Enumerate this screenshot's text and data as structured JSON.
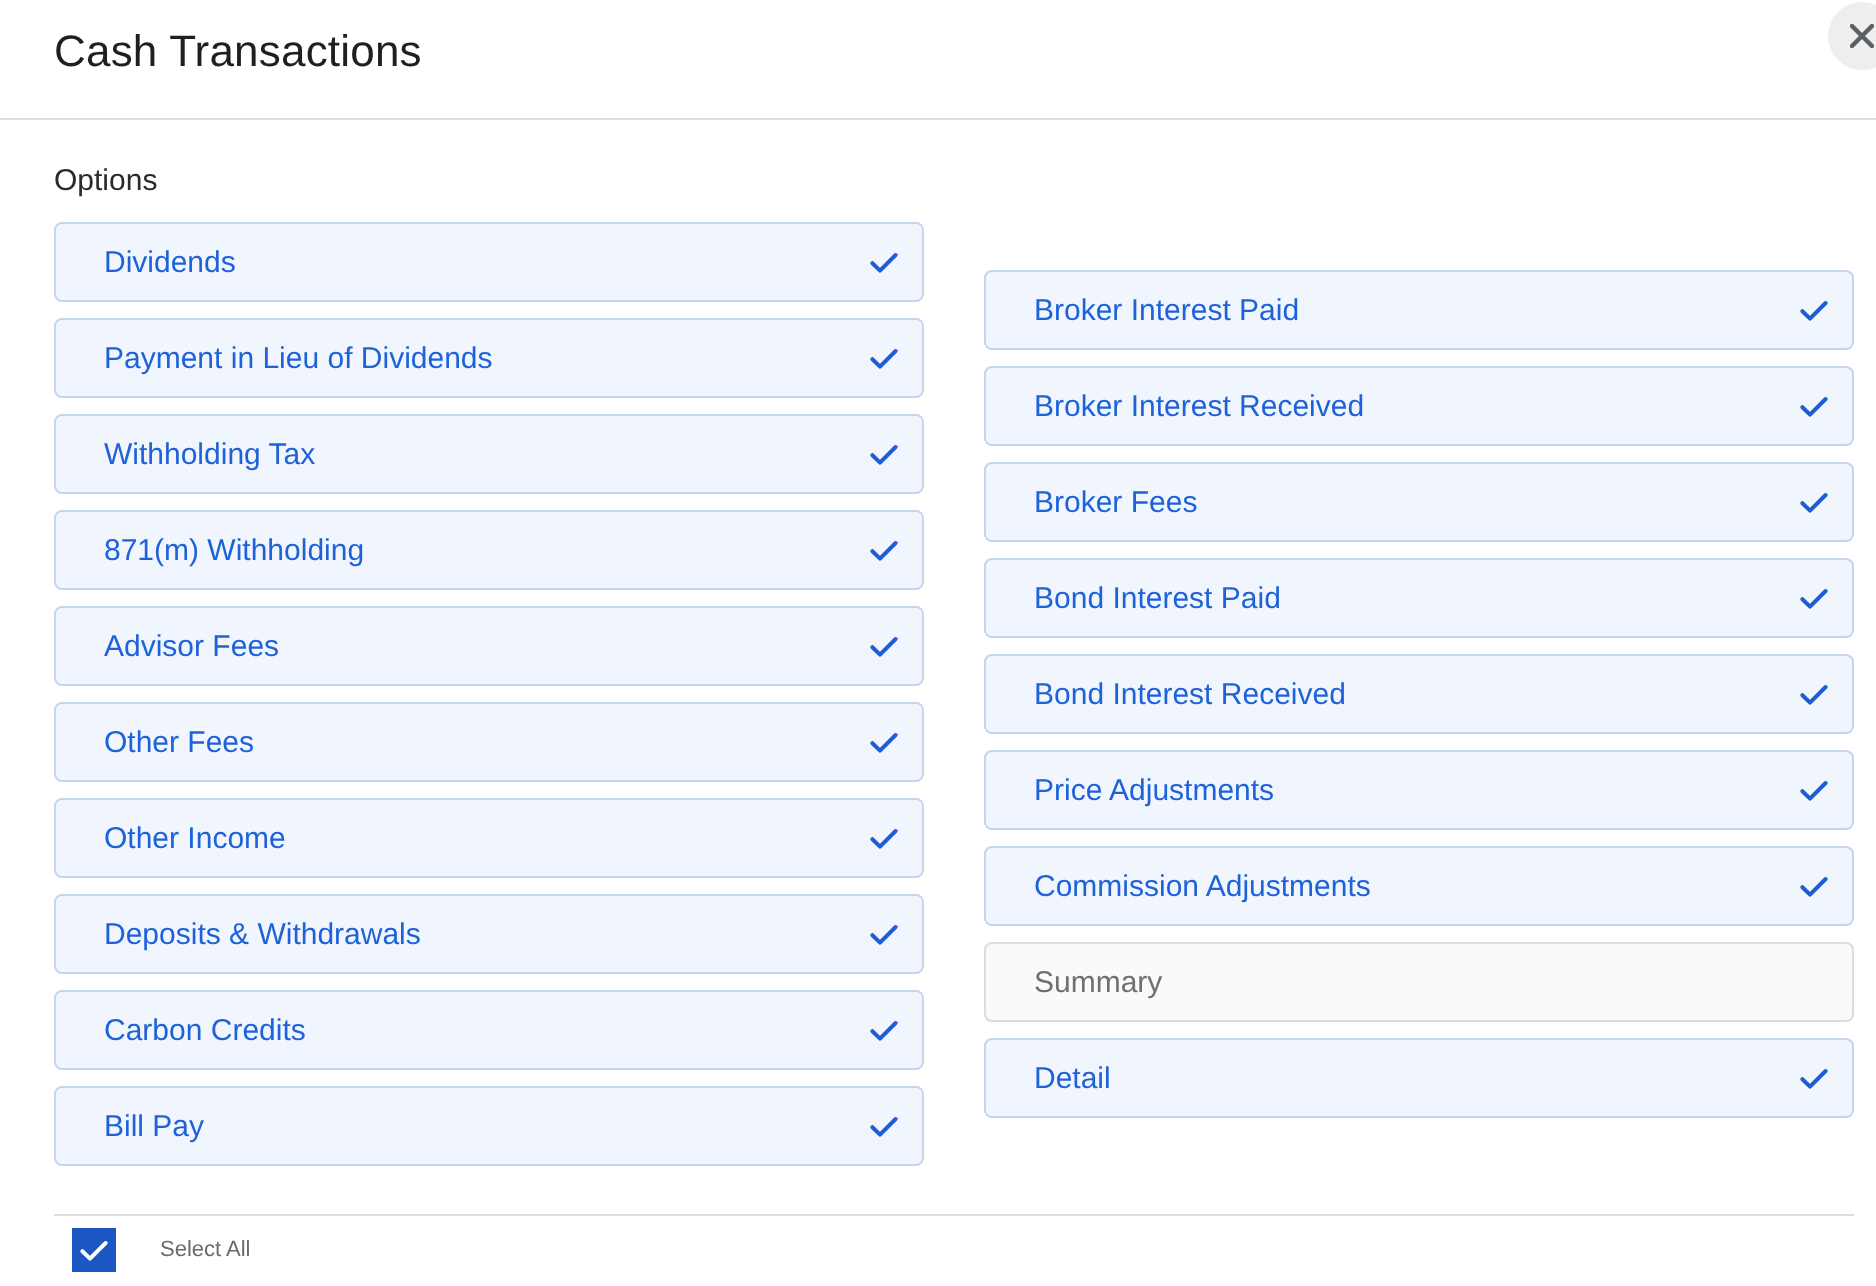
{
  "dialog": {
    "title": "Cash Transactions"
  },
  "options": {
    "label": "Options",
    "columns": [
      {
        "items": [
          {
            "label": "Dividends",
            "selected": true
          },
          {
            "label": "Payment in Lieu of Dividends",
            "selected": true
          },
          {
            "label": "Withholding Tax",
            "selected": true
          },
          {
            "label": "871(m) Withholding",
            "selected": true
          },
          {
            "label": "Advisor Fees",
            "selected": true
          },
          {
            "label": "Other Fees",
            "selected": true
          },
          {
            "label": "Other Income",
            "selected": true
          },
          {
            "label": "Deposits & Withdrawals",
            "selected": true
          },
          {
            "label": "Carbon Credits",
            "selected": true
          },
          {
            "label": "Bill Pay",
            "selected": true
          }
        ]
      },
      {
        "items": [
          {
            "label": "Broker Interest Paid",
            "selected": true
          },
          {
            "label": "Broker Interest Received",
            "selected": true
          },
          {
            "label": "Broker Fees",
            "selected": true
          },
          {
            "label": "Bond Interest Paid",
            "selected": true
          },
          {
            "label": "Bond Interest Received",
            "selected": true
          },
          {
            "label": "Price Adjustments",
            "selected": true
          },
          {
            "label": "Commission Adjustments",
            "selected": true
          },
          {
            "label": "Summary",
            "selected": false
          },
          {
            "label": "Detail",
            "selected": true
          }
        ]
      }
    ]
  },
  "footer": {
    "select_all": {
      "label": "Select All",
      "checked": true
    }
  }
}
